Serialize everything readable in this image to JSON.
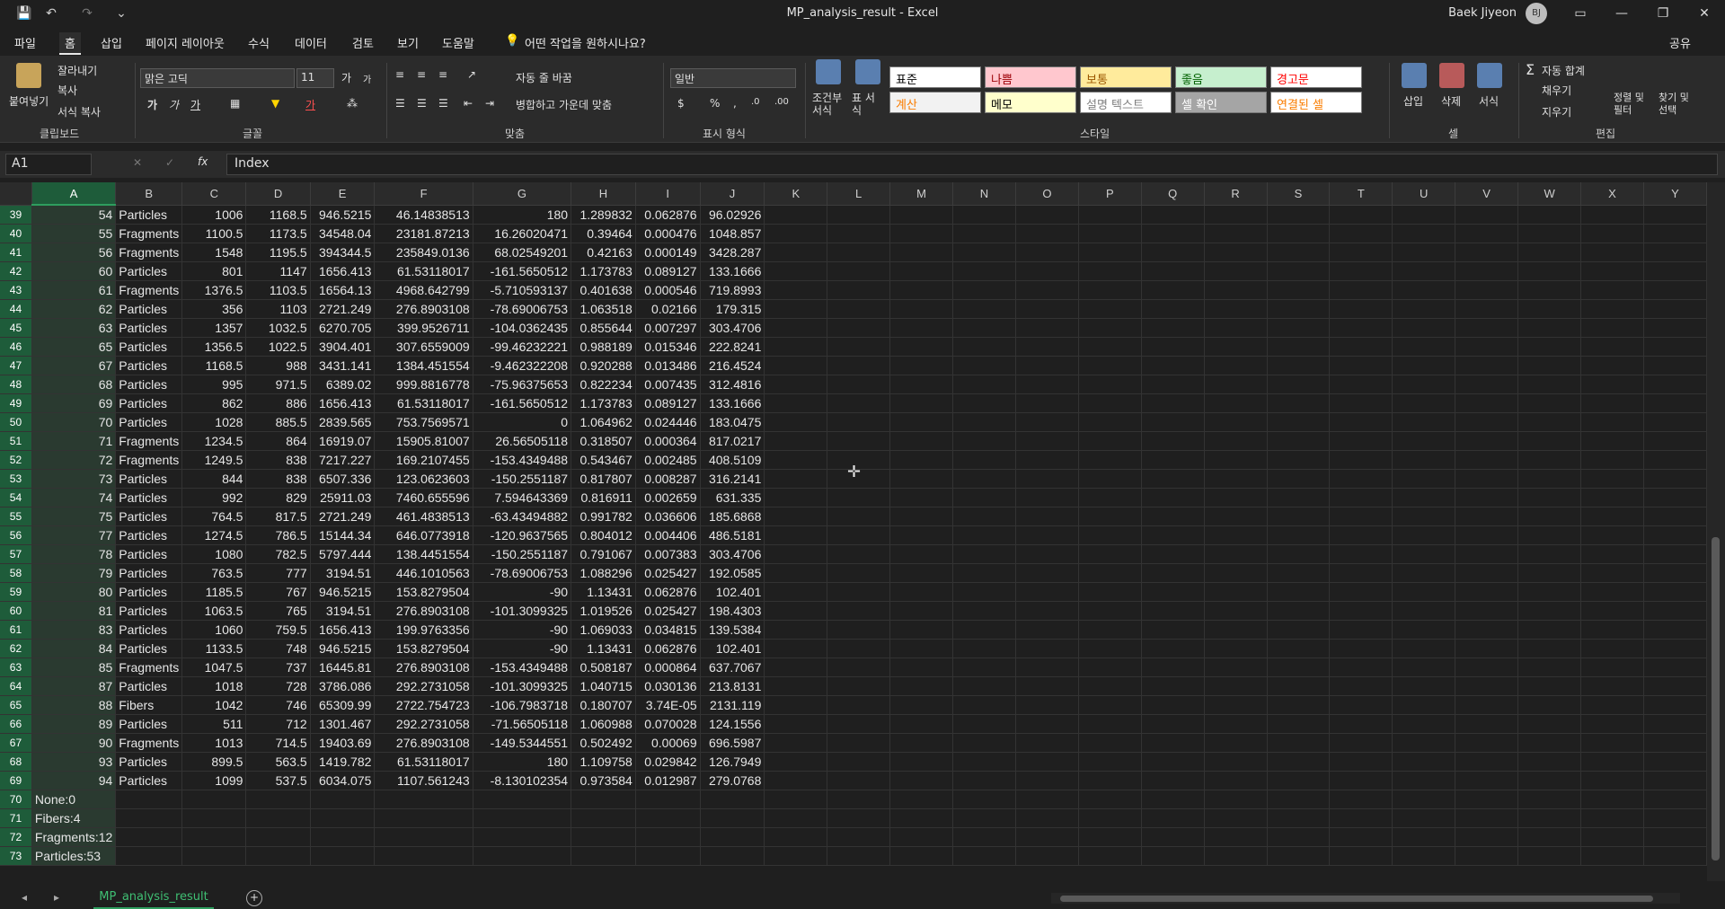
{
  "window": {
    "title": "MP_analysis_result  -  Excel",
    "user": "Baek Jiyeon",
    "avatar": "BJ"
  },
  "quickaccess": {
    "save": "💾",
    "undo": "↶",
    "redo": "↷",
    "more": "⌄"
  },
  "menu": {
    "tabs": [
      "파일",
      "홈",
      "삽입",
      "페이지 레이아웃",
      "수식",
      "데이터",
      "검토",
      "보기",
      "도움말"
    ],
    "tell_me": "어떤 작업을 원하시나요?",
    "share": "공유"
  },
  "ribbon": {
    "clipboard": {
      "label": "클립보드",
      "paste": "붙여넣기",
      "cut": "잘라내기",
      "copy": "복사",
      "format_painter": "서식 복사"
    },
    "font": {
      "label": "글꼴",
      "name": "맑은 고딕",
      "size": "11",
      "grow": "가",
      "shrink": "가",
      "bold": "가",
      "italic": "가",
      "underline": "가",
      "color_a": "가"
    },
    "alignment": {
      "label": "맞춤",
      "wrap": "자동 줄 바꿈",
      "merge": "병합하고 가운데 맞춤"
    },
    "number": {
      "label": "표시 형식",
      "format": "일반",
      "currency": "$",
      "percent": "%",
      "comma": ",",
      "inc": ".0",
      "dec": ".00"
    },
    "styles": {
      "label": "스타일",
      "conditional": "조건부 서식",
      "table": "표 서식",
      "cells": [
        {
          "text": "표준",
          "bg": "#ffffff",
          "fg": "#000000"
        },
        {
          "text": "나쁨",
          "bg": "#ffc7ce",
          "fg": "#9c0006"
        },
        {
          "text": "보통",
          "bg": "#ffeb9c",
          "fg": "#9c5700"
        },
        {
          "text": "좋음",
          "bg": "#c6efce",
          "fg": "#006100"
        },
        {
          "text": "경고문",
          "bg": "#ffffff",
          "fg": "#ff0000"
        },
        {
          "text": "계산",
          "bg": "#f2f2f2",
          "fg": "#fa7d00"
        },
        {
          "text": "메모",
          "bg": "#ffffcc",
          "fg": "#000000"
        },
        {
          "text": "설명 텍스트",
          "bg": "#ffffff",
          "fg": "#7f7f7f"
        },
        {
          "text": "셀 확인",
          "bg": "#a5a5a5",
          "fg": "#ffffff"
        },
        {
          "text": "연결된 셀",
          "bg": "#ffffff",
          "fg": "#fa7d00"
        }
      ]
    },
    "cells": {
      "label": "셀",
      "insert": "삽입",
      "delete": "삭제",
      "format": "서식"
    },
    "editing": {
      "label": "편집",
      "autosum": "자동 합계",
      "fill": "채우기",
      "clear": "지우기",
      "sort": "정렬 및 필터",
      "find": "찾기 및 선택"
    }
  },
  "formula": {
    "namebox": "A1",
    "value": "Index"
  },
  "columns": [
    "A",
    "B",
    "C",
    "D",
    "E",
    "F",
    "G",
    "H",
    "I",
    "J",
    "K",
    "L",
    "M",
    "N",
    "O",
    "P",
    "Q",
    "R",
    "S",
    "T",
    "U",
    "V",
    "W",
    "X",
    "Y"
  ],
  "rows": [
    {
      "n": "39",
      "c": [
        "54",
        "Particles",
        "1006",
        "1168.5",
        "946.5215",
        "46.14838513",
        "180",
        "1.289832",
        "0.062876",
        "96.02926"
      ]
    },
    {
      "n": "40",
      "c": [
        "55",
        "Fragments",
        "1100.5",
        "1173.5",
        "34548.04",
        "23181.87213",
        "16.26020471",
        "0.39464",
        "0.000476",
        "1048.857"
      ]
    },
    {
      "n": "41",
      "c": [
        "56",
        "Fragments",
        "1548",
        "1195.5",
        "394344.5",
        "235849.0136",
        "68.02549201",
        "0.42163",
        "0.000149",
        "3428.287"
      ]
    },
    {
      "n": "42",
      "c": [
        "60",
        "Particles",
        "801",
        "1147",
        "1656.413",
        "61.53118017",
        "-161.5650512",
        "1.173783",
        "0.089127",
        "133.1666"
      ]
    },
    {
      "n": "43",
      "c": [
        "61",
        "Fragments",
        "1376.5",
        "1103.5",
        "16564.13",
        "4968.642799",
        "-5.710593137",
        "0.401638",
        "0.000546",
        "719.8993"
      ]
    },
    {
      "n": "44",
      "c": [
        "62",
        "Particles",
        "356",
        "1103",
        "2721.249",
        "276.8903108",
        "-78.69006753",
        "1.063518",
        "0.02166",
        "179.315"
      ]
    },
    {
      "n": "45",
      "c": [
        "63",
        "Particles",
        "1357",
        "1032.5",
        "6270.705",
        "399.9526711",
        "-104.0362435",
        "0.855644",
        "0.007297",
        "303.4706"
      ]
    },
    {
      "n": "46",
      "c": [
        "65",
        "Particles",
        "1356.5",
        "1022.5",
        "3904.401",
        "307.6559009",
        "-99.46232221",
        "0.988189",
        "0.015346",
        "222.8241"
      ]
    },
    {
      "n": "47",
      "c": [
        "67",
        "Particles",
        "1168.5",
        "988",
        "3431.141",
        "1384.451554",
        "-9.462322208",
        "0.920288",
        "0.013486",
        "216.4524"
      ]
    },
    {
      "n": "48",
      "c": [
        "68",
        "Particles",
        "995",
        "971.5",
        "6389.02",
        "999.8816778",
        "-75.96375653",
        "0.822234",
        "0.007435",
        "312.4816"
      ]
    },
    {
      "n": "49",
      "c": [
        "69",
        "Particles",
        "862",
        "886",
        "1656.413",
        "61.53118017",
        "-161.5650512",
        "1.173783",
        "0.089127",
        "133.1666"
      ]
    },
    {
      "n": "50",
      "c": [
        "70",
        "Particles",
        "1028",
        "885.5",
        "2839.565",
        "753.7569571",
        "0",
        "1.064962",
        "0.024446",
        "183.0475"
      ]
    },
    {
      "n": "51",
      "c": [
        "71",
        "Fragments",
        "1234.5",
        "864",
        "16919.07",
        "15905.81007",
        "26.56505118",
        "0.318507",
        "0.000364",
        "817.0217"
      ]
    },
    {
      "n": "52",
      "c": [
        "72",
        "Fragments",
        "1249.5",
        "838",
        "7217.227",
        "169.2107455",
        "-153.4349488",
        "0.543467",
        "0.002485",
        "408.5109"
      ]
    },
    {
      "n": "53",
      "c": [
        "73",
        "Particles",
        "844",
        "838",
        "6507.336",
        "123.0623603",
        "-150.2551187",
        "0.817807",
        "0.008287",
        "316.2141"
      ]
    },
    {
      "n": "54",
      "c": [
        "74",
        "Particles",
        "992",
        "829",
        "25911.03",
        "7460.655596",
        "7.594643369",
        "0.816911",
        "0.002659",
        "631.335"
      ]
    },
    {
      "n": "55",
      "c": [
        "75",
        "Particles",
        "764.5",
        "817.5",
        "2721.249",
        "461.4838513",
        "-63.43494882",
        "0.991782",
        "0.036606",
        "185.6868"
      ]
    },
    {
      "n": "56",
      "c": [
        "77",
        "Particles",
        "1274.5",
        "786.5",
        "15144.34",
        "646.0773918",
        "-120.9637565",
        "0.804012",
        "0.004406",
        "486.5181"
      ]
    },
    {
      "n": "57",
      "c": [
        "78",
        "Particles",
        "1080",
        "782.5",
        "5797.444",
        "138.4451554",
        "-150.2551187",
        "0.791067",
        "0.007383",
        "303.4706"
      ]
    },
    {
      "n": "58",
      "c": [
        "79",
        "Particles",
        "763.5",
        "777",
        "3194.51",
        "446.1010563",
        "-78.69006753",
        "1.088296",
        "0.025427",
        "192.0585"
      ]
    },
    {
      "n": "59",
      "c": [
        "80",
        "Particles",
        "1185.5",
        "767",
        "946.5215",
        "153.8279504",
        "-90",
        "1.13431",
        "0.062876",
        "102.401"
      ]
    },
    {
      "n": "60",
      "c": [
        "81",
        "Particles",
        "1063.5",
        "765",
        "3194.51",
        "276.8903108",
        "-101.3099325",
        "1.019526",
        "0.025427",
        "198.4303"
      ]
    },
    {
      "n": "61",
      "c": [
        "83",
        "Particles",
        "1060",
        "759.5",
        "1656.413",
        "199.9763356",
        "-90",
        "1.069033",
        "0.034815",
        "139.5384"
      ]
    },
    {
      "n": "62",
      "c": [
        "84",
        "Particles",
        "1133.5",
        "748",
        "946.5215",
        "153.8279504",
        "-90",
        "1.13431",
        "0.062876",
        "102.401"
      ]
    },
    {
      "n": "63",
      "c": [
        "85",
        "Fragments",
        "1047.5",
        "737",
        "16445.81",
        "276.8903108",
        "-153.4349488",
        "0.508187",
        "0.000864",
        "637.7067"
      ]
    },
    {
      "n": "64",
      "c": [
        "87",
        "Particles",
        "1018",
        "728",
        "3786.086",
        "292.2731058",
        "-101.3099325",
        "1.040715",
        "0.030136",
        "213.8131"
      ]
    },
    {
      "n": "65",
      "c": [
        "88",
        "Fibers",
        "1042",
        "746",
        "65309.99",
        "2722.754723",
        "-106.7983718",
        "0.180707",
        "3.74E-05",
        "2131.119"
      ]
    },
    {
      "n": "66",
      "c": [
        "89",
        "Particles",
        "511",
        "712",
        "1301.467",
        "292.2731058",
        "-71.56505118",
        "1.060988",
        "0.070028",
        "124.1556"
      ]
    },
    {
      "n": "67",
      "c": [
        "90",
        "Fragments",
        "1013",
        "714.5",
        "19403.69",
        "276.8903108",
        "-149.5344551",
        "0.502492",
        "0.00069",
        "696.5987"
      ]
    },
    {
      "n": "68",
      "c": [
        "93",
        "Particles",
        "899.5",
        "563.5",
        "1419.782",
        "61.53118017",
        "180",
        "1.109758",
        "0.029842",
        "126.7949"
      ]
    },
    {
      "n": "69",
      "c": [
        "94",
        "Particles",
        "1099",
        "537.5",
        "6034.075",
        "1107.561243",
        "-8.130102354",
        "0.973584",
        "0.012987",
        "279.0768"
      ]
    },
    {
      "n": "70",
      "c": [
        "None:0",
        "",
        "",
        "",
        "",
        "",
        "",
        "",
        "",
        ""
      ]
    },
    {
      "n": "71",
      "c": [
        "Fibers:4",
        "",
        "",
        "",
        "",
        "",
        "",
        "",
        "",
        ""
      ]
    },
    {
      "n": "72",
      "c": [
        "Fragments:12",
        "",
        "",
        "",
        "",
        "",
        "",
        "",
        "",
        ""
      ]
    },
    {
      "n": "73",
      "c": [
        "Particles:53",
        "",
        "",
        "",
        "",
        "",
        "",
        "",
        "",
        ""
      ]
    }
  ],
  "sheet": {
    "tab": "MP_analysis_result",
    "add": "+"
  }
}
